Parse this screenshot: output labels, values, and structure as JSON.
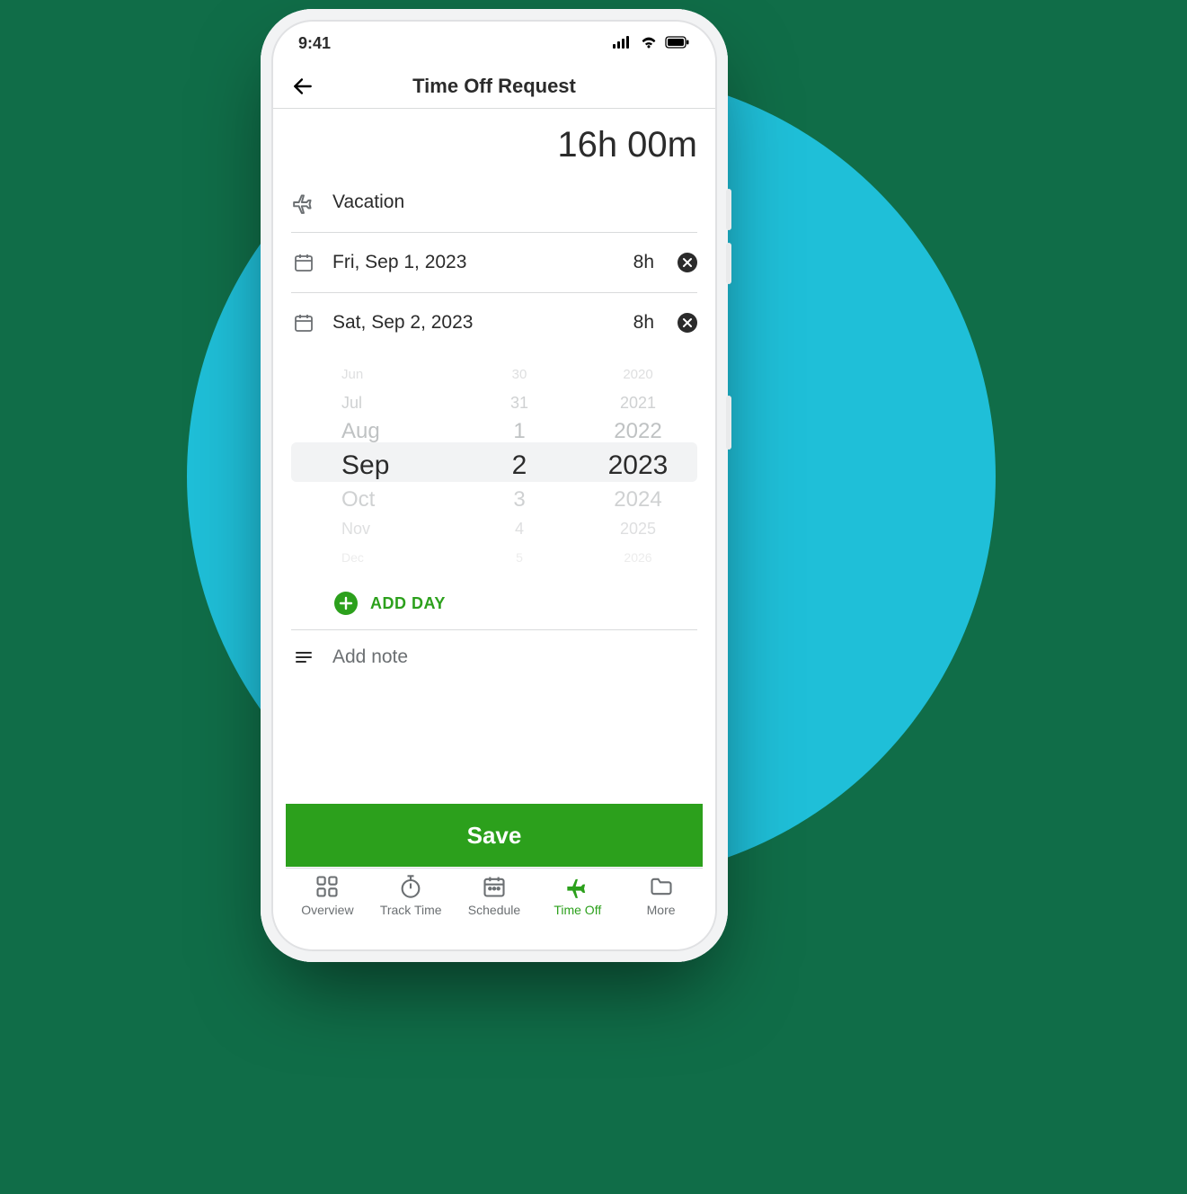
{
  "status": {
    "time": "9:41"
  },
  "topbar": {
    "title": "Time Off Request"
  },
  "total": "16h 00m",
  "type": {
    "label": "Vacation"
  },
  "days": [
    {
      "date": "Fri, Sep 1, 2023",
      "hours": "8h"
    },
    {
      "date": "Sat, Sep 2, 2023",
      "hours": "8h"
    }
  ],
  "picker": {
    "rows": [
      {
        "m": "Jun",
        "d": "30",
        "y": "2020"
      },
      {
        "m": "Jul",
        "d": "31",
        "y": "2021"
      },
      {
        "m": "Aug",
        "d": "1",
        "y": "2022"
      },
      {
        "m": "Sep",
        "d": "2",
        "y": "2023"
      },
      {
        "m": "Oct",
        "d": "3",
        "y": "2024"
      },
      {
        "m": "Nov",
        "d": "4",
        "y": "2025"
      },
      {
        "m": "Dec",
        "d": "5",
        "y": "2026"
      }
    ]
  },
  "addDay": "ADD DAY",
  "addNote": "Add note",
  "saveLabel": "Save",
  "tabs": [
    {
      "label": "Overview"
    },
    {
      "label": "Track Time"
    },
    {
      "label": "Schedule"
    },
    {
      "label": "Time Off"
    },
    {
      "label": "More"
    }
  ]
}
